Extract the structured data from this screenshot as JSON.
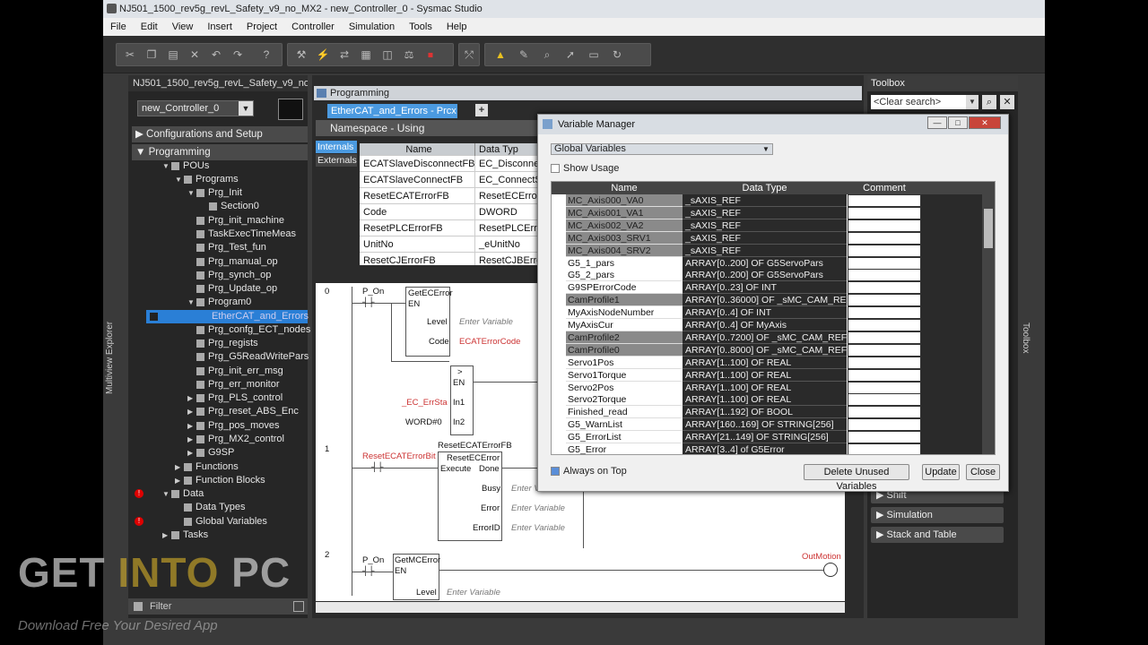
{
  "window": {
    "title": "NJ501_1500_rev5g_revL_Safety_v9_no_MX2 - new_Controller_0 - Sysmac Studio"
  },
  "menu": [
    "File",
    "Edit",
    "View",
    "Insert",
    "Project",
    "Controller",
    "Simulation",
    "Tools",
    "Help"
  ],
  "toolbar_icons": [
    "cut-icon",
    "copy-icon",
    "paste-icon",
    "delete-icon",
    "undo-icon",
    "redo-icon",
    "build-icon",
    "online-icon",
    "sync-icon",
    "transfer-icon",
    "monitor-icon",
    "compare-icon",
    "stop-icon",
    "cross-ref-icon",
    "warning-icon",
    "clear-icon",
    "search-icon",
    "force-icon",
    "set-icon",
    "refresh-icon"
  ],
  "left": {
    "title": "NJ501_1500_rev5g_revL_Safety_v9_no...",
    "controller": "new_Controller_0",
    "config_section": "Configurations and Setup",
    "programming_section": "Programming",
    "multiview_label": "Multiview Explorer",
    "filter_label": "Filter",
    "tree": [
      {
        "label": "POUs"
      },
      {
        "label": "Programs"
      },
      {
        "label": "Prg_Init"
      },
      {
        "label": "Section0"
      },
      {
        "label": "Prg_init_machine"
      },
      {
        "label": "TaskExecTimeMeas"
      },
      {
        "label": "Prg_Test_fun"
      },
      {
        "label": "Prg_manual_op"
      },
      {
        "label": "Prg_synch_op"
      },
      {
        "label": "Prg_Update_op"
      },
      {
        "label": "Program0"
      },
      {
        "label": "EtherCAT_and_Errors"
      },
      {
        "label": "Prg_confg_ECT_nodes"
      },
      {
        "label": "Prg_regists"
      },
      {
        "label": "Prg_G5ReadWritePars"
      },
      {
        "label": "Prg_init_err_msg"
      },
      {
        "label": "Prg_err_monitor"
      },
      {
        "label": "Prg_PLS_control"
      },
      {
        "label": "Prg_reset_ABS_Enc"
      },
      {
        "label": "Prg_pos_moves"
      },
      {
        "label": "Prg_MX2_control"
      },
      {
        "label": "G9SP"
      },
      {
        "label": "Functions"
      },
      {
        "label": "Function Blocks"
      },
      {
        "label": "Data"
      },
      {
        "label": "Data Types"
      },
      {
        "label": "Global Variables"
      },
      {
        "label": "Tasks"
      }
    ]
  },
  "center": {
    "panel_title": "Programming",
    "tab": "EtherCAT_and_Errors - Prcx",
    "namespace": "Namespace - Using",
    "internals": "Internals",
    "externals": "Externals",
    "var_header": {
      "name": "Name",
      "type": "Data Typ"
    },
    "vars": [
      {
        "name": "ECATSlaveDisconnectFB",
        "type": "EC_Disconnec"
      },
      {
        "name": "ECATSlaveConnectFB",
        "type": "EC_ConnectSl"
      },
      {
        "name": "ResetECATErrorFB",
        "type": "ResetECError"
      },
      {
        "name": "Code",
        "type": "DWORD"
      },
      {
        "name": "ResetPLCErrorFB",
        "type": "ResetPLCErro"
      },
      {
        "name": "UnitNo",
        "type": "_eUnitNo"
      },
      {
        "name": "ResetCJErrorFB",
        "type": "ResetCJBErro"
      }
    ],
    "ladder": {
      "r0": "0",
      "r1": "1",
      "r2": "2",
      "p_on": "P_On",
      "getecerror": "GetECError",
      "en": "EN",
      "level": "Level",
      "enter_var": "Enter Variable",
      "code": "Code",
      "ecat_code": "ECATErrorCode",
      "gt": ">",
      "ec_errsta": "_EC_ErrSta",
      "in1": "In1",
      "word0": "WORD#0",
      "in2": "In2",
      "reset_bit": "ResetECATErrorBit",
      "resetfb": "ResetECATErrorFB",
      "resetec": "ResetECError",
      "execute": "Execute",
      "done": "Done",
      "busy": "Busy",
      "error": "Error",
      "errorid": "ErrorID",
      "getmcerror": "GetMCError",
      "outmotion": "OutMotion"
    }
  },
  "right": {
    "title": "Toolbox",
    "search_placeholder": "<Clear search>",
    "side_label": "Toolbox",
    "items": [
      "Shift",
      "Simulation",
      "Stack and Table"
    ]
  },
  "variable_manager": {
    "title": "Variable Manager",
    "scope": "Global Variables",
    "show_usage": "Show Usage",
    "header": {
      "name": "Name",
      "type": "Data Type",
      "comment": "Comment"
    },
    "rows": [
      {
        "name": "MC_Axis000_VA0",
        "type": "_sAXIS_REF",
        "shade": "gray"
      },
      {
        "name": "MC_Axis001_VA1",
        "type": "_sAXIS_REF",
        "shade": "gray"
      },
      {
        "name": "MC_Axis002_VA2",
        "type": "_sAXIS_REF",
        "shade": "gray"
      },
      {
        "name": "MC_Axis003_SRV1",
        "type": "_sAXIS_REF",
        "shade": "gray"
      },
      {
        "name": "MC_Axis004_SRV2",
        "type": "_sAXIS_REF",
        "shade": "gray"
      },
      {
        "name": "G5_1_pars",
        "type": "ARRAY[0..200] OF G5ServoPars",
        "shade": "white"
      },
      {
        "name": "G5_2_pars",
        "type": "ARRAY[0..200] OF G5ServoPars",
        "shade": "white"
      },
      {
        "name": "G9SPErrorCode",
        "type": "ARRAY[0..23] OF INT",
        "shade": "white"
      },
      {
        "name": "CamProfile1",
        "type": "ARRAY[0..36000] OF _sMC_CAM_REF",
        "shade": "gray"
      },
      {
        "name": "MyAxisNodeNumber",
        "type": "ARRAY[0..4] OF INT",
        "shade": "white"
      },
      {
        "name": "MyAxisCur",
        "type": "ARRAY[0..4] OF MyAxis",
        "shade": "white"
      },
      {
        "name": "CamProfile2",
        "type": "ARRAY[0..7200] OF _sMC_CAM_REF",
        "shade": "gray"
      },
      {
        "name": "CamProfile0",
        "type": "ARRAY[0..8000] OF _sMC_CAM_REF",
        "shade": "gray"
      },
      {
        "name": "Servo1Pos",
        "type": "ARRAY[1..100] OF REAL",
        "shade": "white"
      },
      {
        "name": "Servo1Torque",
        "type": "ARRAY[1..100] OF REAL",
        "shade": "white"
      },
      {
        "name": "Servo2Pos",
        "type": "ARRAY[1..100] OF REAL",
        "shade": "white"
      },
      {
        "name": "Servo2Torque",
        "type": "ARRAY[1..100] OF REAL",
        "shade": "white"
      },
      {
        "name": "Finished_read",
        "type": "ARRAY[1..192] OF BOOL",
        "shade": "white"
      },
      {
        "name": "G5_WarnList",
        "type": "ARRAY[160..169] OF STRING[256]",
        "shade": "white"
      },
      {
        "name": "G5_ErrorList",
        "type": "ARRAY[21..149] OF STRING[256]",
        "shade": "white"
      },
      {
        "name": "G5_Error",
        "type": "ARRAY[3..4] of G5Error",
        "shade": "white"
      }
    ],
    "always_on_top": "Always on Top",
    "delete_unused": "Delete Unused Variables",
    "update": "Update",
    "close": "Close"
  },
  "watermark": {
    "get": "GET ",
    "into": "INTO",
    "pc": " PC",
    "sub": "Download Free Your Desired App"
  }
}
